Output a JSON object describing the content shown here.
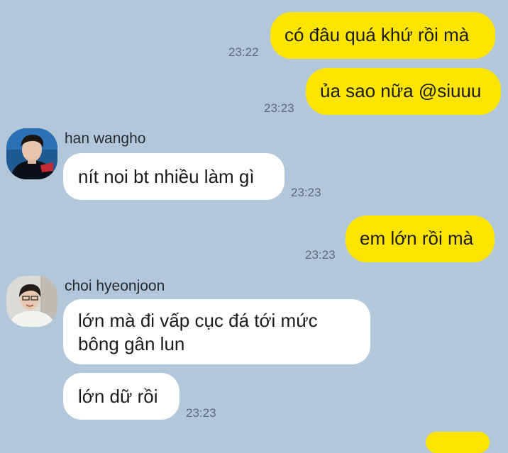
{
  "messages": [
    {
      "text": "có đâu quá khứ rồi mà",
      "time": "23:22"
    },
    {
      "text": "ủa sao nữa @siuuu",
      "time": "23:23"
    },
    {
      "sender": "han wangho",
      "text": "nít noi bt nhiều làm gì",
      "time": "23:23"
    },
    {
      "text": "em lớn rồi mà",
      "time": "23:23"
    },
    {
      "sender": "choi hyeonjoon",
      "text_line1": "lớn mà đi vấp cục đá tới mức",
      "text_line2": "bông gân lun"
    },
    {
      "text": "lớn dữ rồi",
      "time": "23:23"
    }
  ],
  "colors": {
    "background": "#b2c7da",
    "outgoing_bubble": "#fee500",
    "incoming_bubble": "#ffffff",
    "timestamp": "#5e6b79"
  },
  "icons": [
    "han-wangho-avatar",
    "choi-hyeonjoon-avatar"
  ]
}
